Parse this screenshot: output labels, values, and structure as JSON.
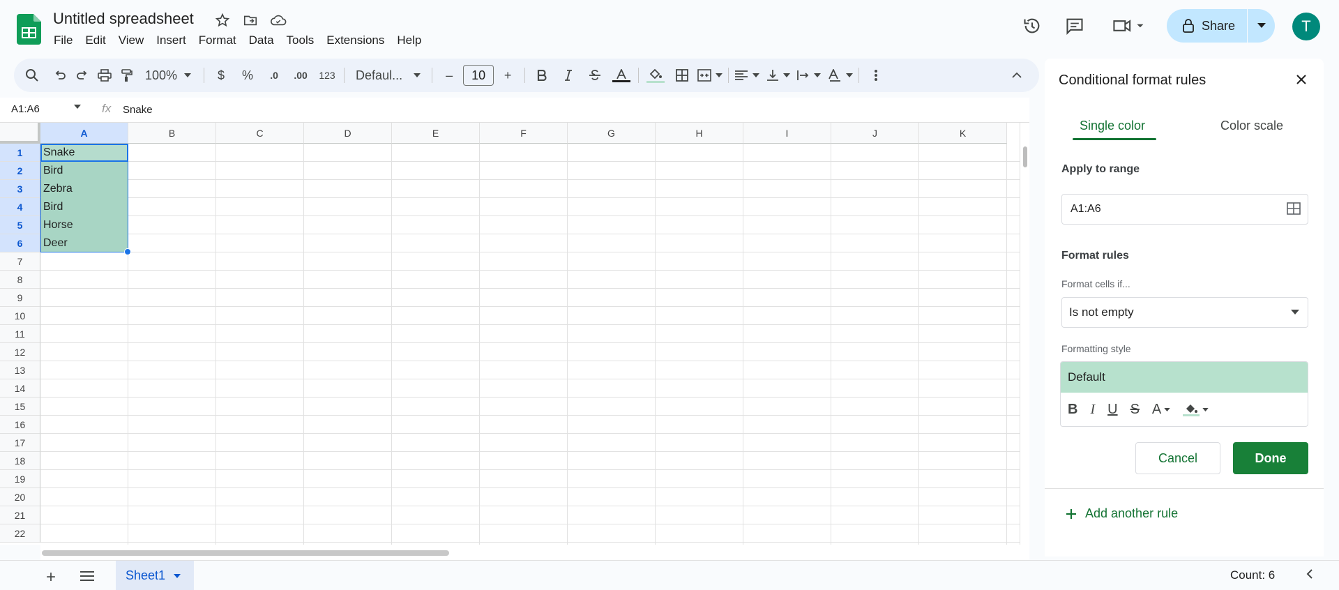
{
  "app": {
    "doc_title": "Untitled spreadsheet",
    "menu": [
      "File",
      "Edit",
      "View",
      "Insert",
      "Format",
      "Data",
      "Tools",
      "Extensions",
      "Help"
    ],
    "share_label": "Share",
    "avatar_initial": "T"
  },
  "toolbar": {
    "zoom": "100%",
    "currency": "$",
    "percent": "%",
    "decrease_decimal": ".0",
    "increase_decimal": ".00",
    "number_format": "123",
    "font": "Defaul...",
    "font_size": "10",
    "minus": "–",
    "plus": "+"
  },
  "formula_bar": {
    "name_box": "A1:A6",
    "fx": "fx",
    "formula": "Snake"
  },
  "grid": {
    "columns": [
      "A",
      "B",
      "C",
      "D",
      "E",
      "F",
      "G",
      "H",
      "I",
      "J",
      "K"
    ],
    "rows": [
      "1",
      "2",
      "3",
      "4",
      "5",
      "6",
      "7",
      "8",
      "9",
      "10",
      "11",
      "12",
      "13",
      "14",
      "15",
      "16",
      "17",
      "18",
      "19",
      "20",
      "21",
      "22"
    ],
    "column_a_values": [
      "Snake",
      "Bird",
      "Zebra",
      "Bird",
      "Horse",
      "Deer"
    ]
  },
  "sheetbar": {
    "add": "+",
    "sheet_tab": "Sheet1",
    "count": "Count: 6"
  },
  "panel": {
    "title": "Conditional format rules",
    "tab_single": "Single color",
    "tab_scale": "Color scale",
    "apply_to_range_label": "Apply to range",
    "range_value": "A1:A6",
    "format_rules_label": "Format rules",
    "format_cells_if_label": "Format cells if...",
    "condition": "Is not empty",
    "formatting_style_label": "Formatting style",
    "style_preview": "Default",
    "style_tools": [
      "B",
      "I",
      "U",
      "S",
      "A"
    ],
    "cancel": "Cancel",
    "done": "Done",
    "add_rule": "Add another rule",
    "preview_color": "#b7e1cd"
  }
}
